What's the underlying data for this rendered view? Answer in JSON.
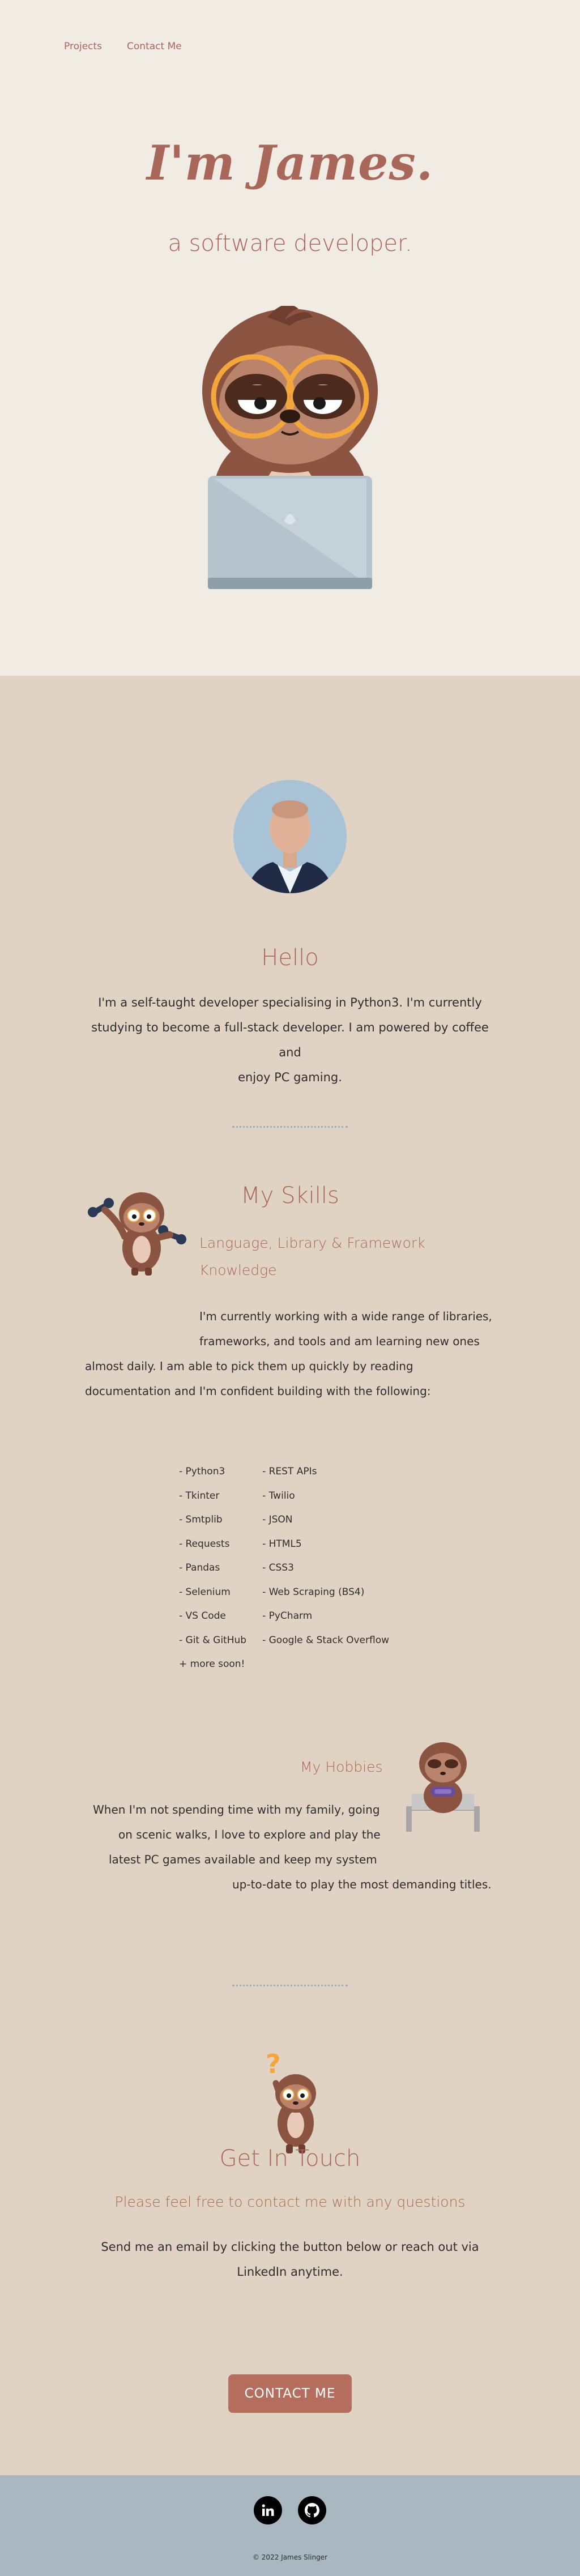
{
  "nav": {
    "projects": "Projects",
    "contact": "Contact Me"
  },
  "hero": {
    "title": "I'm James.",
    "subtitle": "a software developer."
  },
  "about": {
    "heading": "Hello",
    "lines": [
      "I'm a self-taught developer specialising in Python3. I'm currently",
      "studying to become a full-stack developer. I am powered by coffee and",
      "enjoy PC gaming."
    ]
  },
  "skills": {
    "heading": "My Skills",
    "subheading_lines": [
      "Language, Library & Framework",
      "Knowledge"
    ],
    "para_lines": [
      "I'm currently working with a wide range of libraries,",
      "frameworks, and tools and am learning new ones",
      "almost daily. I am able to pick them up quickly by reading",
      "documentation and I'm confident building with the following:"
    ],
    "col1": [
      "- Python3",
      "- Tkinter",
      "- Smtplib",
      "- Requests",
      "- Pandas",
      "- Selenium",
      "- VS Code",
      "- Git & GitHub",
      "+ more soon!"
    ],
    "col2": [
      "- REST APIs",
      "- Twilio",
      "- JSON",
      "- HTML5",
      "- CSS3",
      "- Web Scraping (BS4)",
      "- PyCharm",
      "- Google & Stack Overflow"
    ]
  },
  "hobbies": {
    "heading": "My Hobbies",
    "lines": [
      "When I'm not spending time with my family, going",
      "on scenic walks, I love to explore and play the",
      "latest PC games available and keep my system",
      "up-to-date to play the most demanding titles."
    ]
  },
  "contact": {
    "heading": "Get In Touch",
    "subheading": "Please feel free to contact me with any questions",
    "lines": [
      "Send me an email by clicking the button below or reach out via",
      "LinkedIn anytime."
    ],
    "button": "CONTACT ME"
  },
  "footer": {
    "copyright": "© 2022 James Slinger"
  },
  "icons": {
    "linkedin": "linkedin-icon",
    "github": "github-icon"
  },
  "colors": {
    "hero_bg": "#f0ebe3",
    "main_bg": "#e0d3c3",
    "accent": "#a9675a",
    "button": "#b56e5e",
    "footer_bg": "#a9b7c0",
    "divider": "#9ab0bd"
  }
}
